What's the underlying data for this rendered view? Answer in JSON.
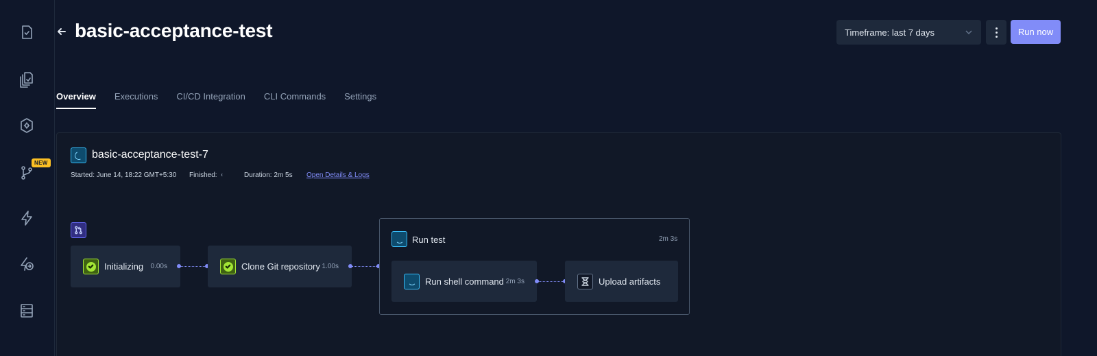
{
  "sidebar": {
    "items": [
      {
        "icon": "test-icon"
      },
      {
        "icon": "test-suites-icon"
      },
      {
        "icon": "executors-icon"
      },
      {
        "icon": "workflows-icon",
        "badge": "NEW"
      },
      {
        "icon": "triggers-icon"
      },
      {
        "icon": "webhooks-icon"
      },
      {
        "icon": "sources-icon"
      }
    ]
  },
  "header": {
    "title": "basic-acceptance-test",
    "timeframe": "Timeframe: last 7 days",
    "run_now": "Run now"
  },
  "tabs": [
    {
      "label": "Overview",
      "active": true
    },
    {
      "label": "Executions",
      "active": false
    },
    {
      "label": "CI/CD Integration",
      "active": false
    },
    {
      "label": "CLI Commands",
      "active": false
    },
    {
      "label": "Settings",
      "active": false
    }
  ],
  "execution": {
    "name": "basic-acceptance-test-7",
    "started": "Started: June 14, 18:22 GMT+5:30",
    "finished": "Finished:",
    "duration": "Duration: 2m 5s",
    "details_link": "Open Details & Logs"
  },
  "steps": [
    {
      "label": "Initializing",
      "duration": "0.00s",
      "status": "passed"
    },
    {
      "label": "Clone Git repository",
      "duration": "1.00s",
      "status": "passed"
    }
  ],
  "group": {
    "label": "Run test",
    "duration": "2m 3s",
    "status": "running",
    "children": [
      {
        "label": "Run shell command",
        "duration": "2m 3s",
        "status": "running"
      },
      {
        "label": "Upload artifacts",
        "duration": "",
        "status": "queued"
      }
    ]
  },
  "colors": {
    "background": "#0f172a",
    "accent": "#818cf8",
    "success": "#a3e635",
    "running": "#38bdf8",
    "badge": "#fbbf24"
  }
}
